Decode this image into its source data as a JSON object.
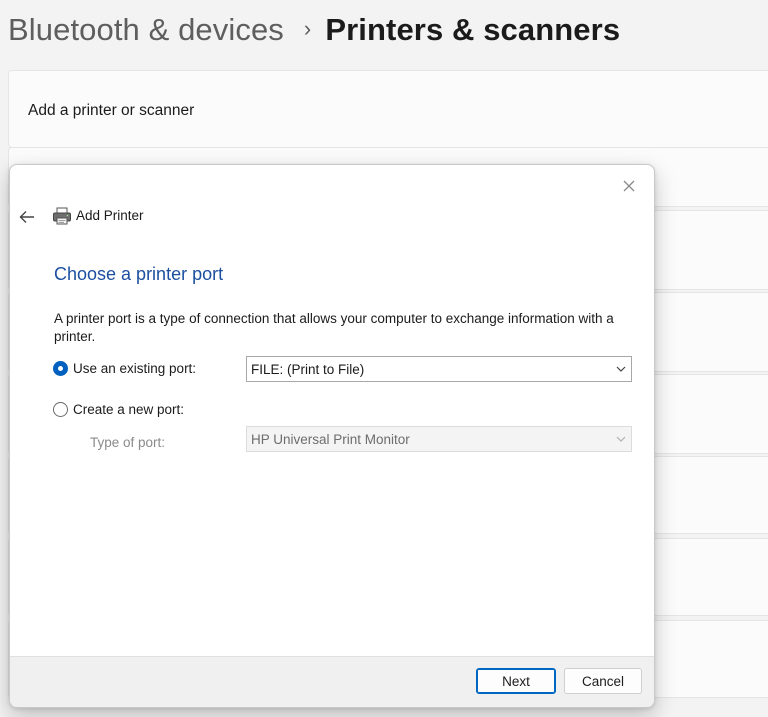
{
  "breadcrumb": {
    "parent": "Bluetooth & devices",
    "separator": "›",
    "current": "Printers & scanners"
  },
  "settings": {
    "add_card_title": "Add a printer or scanner"
  },
  "dialog": {
    "title": "Add Printer",
    "heading": "Choose a printer port",
    "description": "A printer port is a type of connection that allows your computer to exchange information with a printer.",
    "existing_port": {
      "label": "Use an existing port:",
      "selected": true,
      "value": "FILE: (Print to File)"
    },
    "new_port": {
      "label": "Create a new port:",
      "selected": false,
      "type_label": "Type of port:",
      "value": "HP Universal Print Monitor"
    },
    "buttons": {
      "next": "Next",
      "cancel": "Cancel"
    }
  },
  "colors": {
    "accent": "#0060c0",
    "heading": "#1c4fa0"
  },
  "icons": [
    "close-icon",
    "back-arrow-icon",
    "printer-icon",
    "chevron-down-icon"
  ]
}
